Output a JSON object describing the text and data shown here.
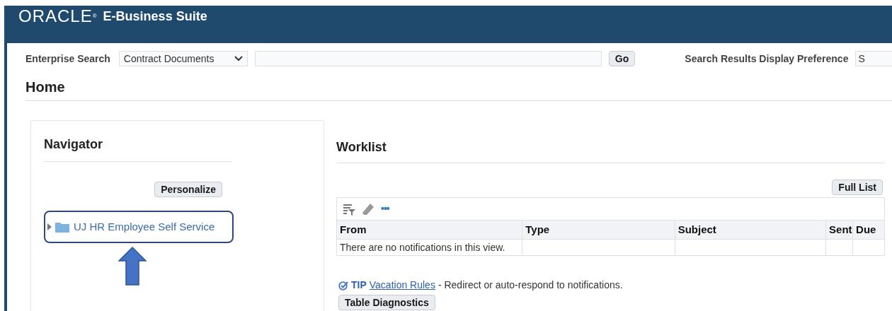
{
  "header": {
    "logo": "ORACLE",
    "logo_mark": "®",
    "product": "E-Business Suite"
  },
  "search": {
    "label": "Enterprise Search",
    "category": "Contract Documents",
    "button": "Go",
    "preference_label": "Search Results Display Preference",
    "preference_value": "S"
  },
  "page_title": "Home",
  "navigator": {
    "title": "Navigator",
    "personalize": "Personalize",
    "items": [
      {
        "label": "UJ HR Employee Self Service",
        "expanded": false,
        "highlighted": true
      }
    ]
  },
  "worklist": {
    "title": "Worklist",
    "full_list": "Full List",
    "more": "•••",
    "columns": [
      "From",
      "Type",
      "Subject",
      "Sent",
      "Due"
    ],
    "rows": [
      [
        "There are no notifications in this view.",
        "",
        "",
        "",
        ""
      ]
    ]
  },
  "tip": {
    "label": "TIP",
    "link": "Vacation Rules",
    "text": "- Redirect or auto-respond to notifications."
  },
  "diagnostics_button": "Table Diagnostics"
}
